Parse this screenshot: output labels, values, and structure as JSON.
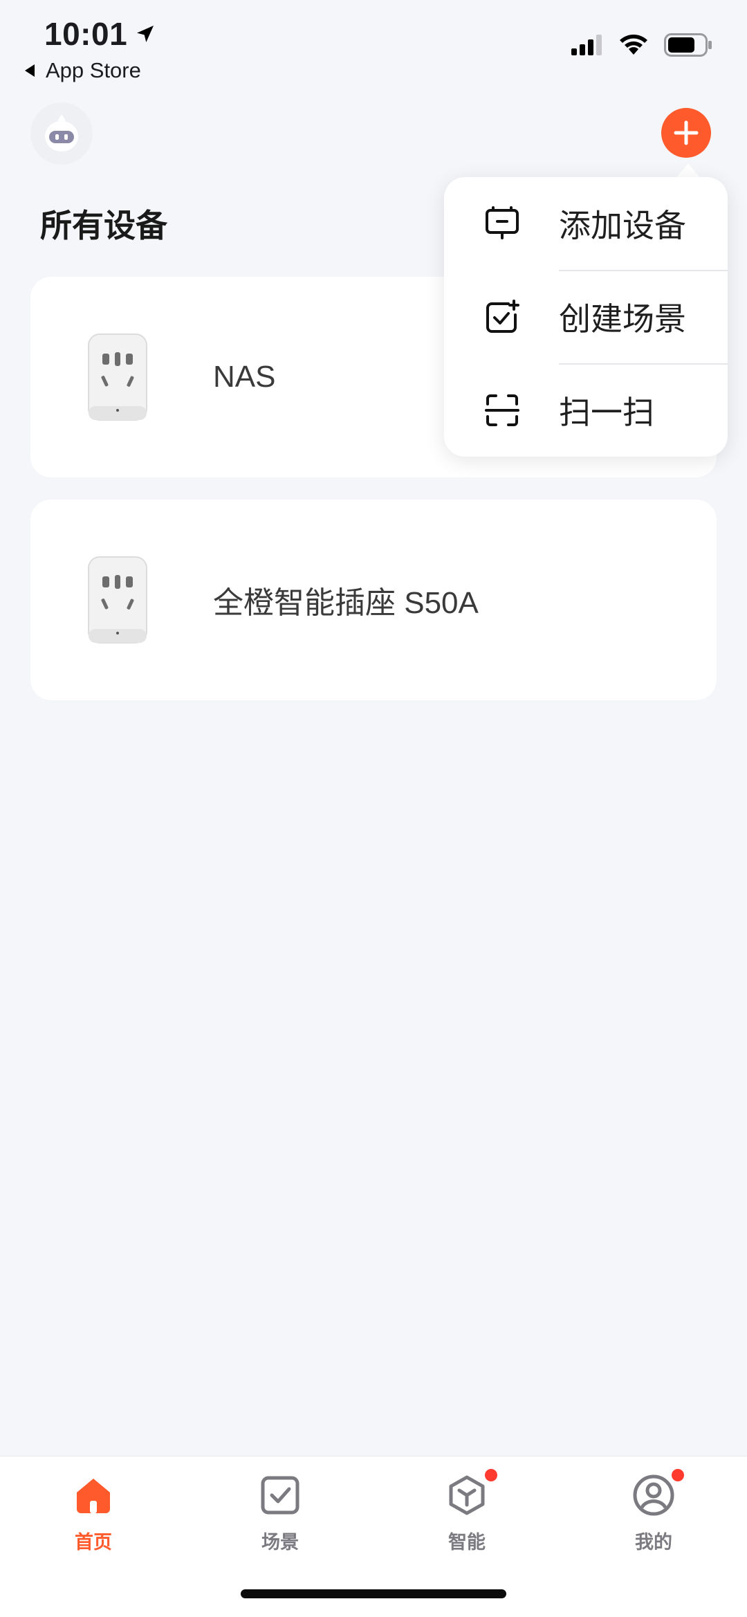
{
  "status_bar": {
    "time": "10:01",
    "back_label": "App Store"
  },
  "header": {
    "title": "所有设备"
  },
  "devices": [
    {
      "name": "NAS"
    },
    {
      "name": "全橙智能插座 S50A"
    }
  ],
  "popup_menu": {
    "items": [
      {
        "label": "添加设备",
        "icon": "add-device-icon"
      },
      {
        "label": "创建场景",
        "icon": "create-scene-icon"
      },
      {
        "label": "扫一扫",
        "icon": "scan-icon"
      }
    ]
  },
  "tab_bar": {
    "tabs": [
      {
        "label": "首页",
        "icon": "home-icon",
        "active": true,
        "badge": false
      },
      {
        "label": "场景",
        "icon": "scene-icon",
        "active": false,
        "badge": false
      },
      {
        "label": "智能",
        "icon": "smart-cube-icon",
        "active": false,
        "badge": true
      },
      {
        "label": "我的",
        "icon": "profile-icon",
        "active": false,
        "badge": true
      }
    ]
  },
  "colors": {
    "accent": "#ff5a2b",
    "background": "#f5f6fa",
    "badge": "#ff3b30"
  }
}
